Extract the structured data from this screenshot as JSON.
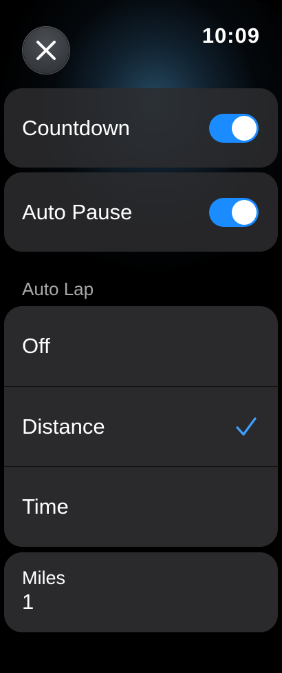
{
  "status": {
    "time": "10:09"
  },
  "header": {
    "close_icon": "close-icon"
  },
  "settings": {
    "countdown": {
      "label": "Countdown",
      "enabled": true
    },
    "auto_pause": {
      "label": "Auto Pause",
      "enabled": true
    }
  },
  "auto_lap": {
    "header": "Auto Lap",
    "options": [
      "Off",
      "Distance",
      "Time"
    ],
    "selected": "Distance",
    "check_icon": "checkmark-icon"
  },
  "distance_value": {
    "unit": "Miles",
    "value": "1"
  },
  "colors": {
    "toggle_on": "#1a8cff",
    "checkmark": "#3ea0ff",
    "card_bg": "#2c2c2e",
    "screen_bg": "#000000"
  }
}
